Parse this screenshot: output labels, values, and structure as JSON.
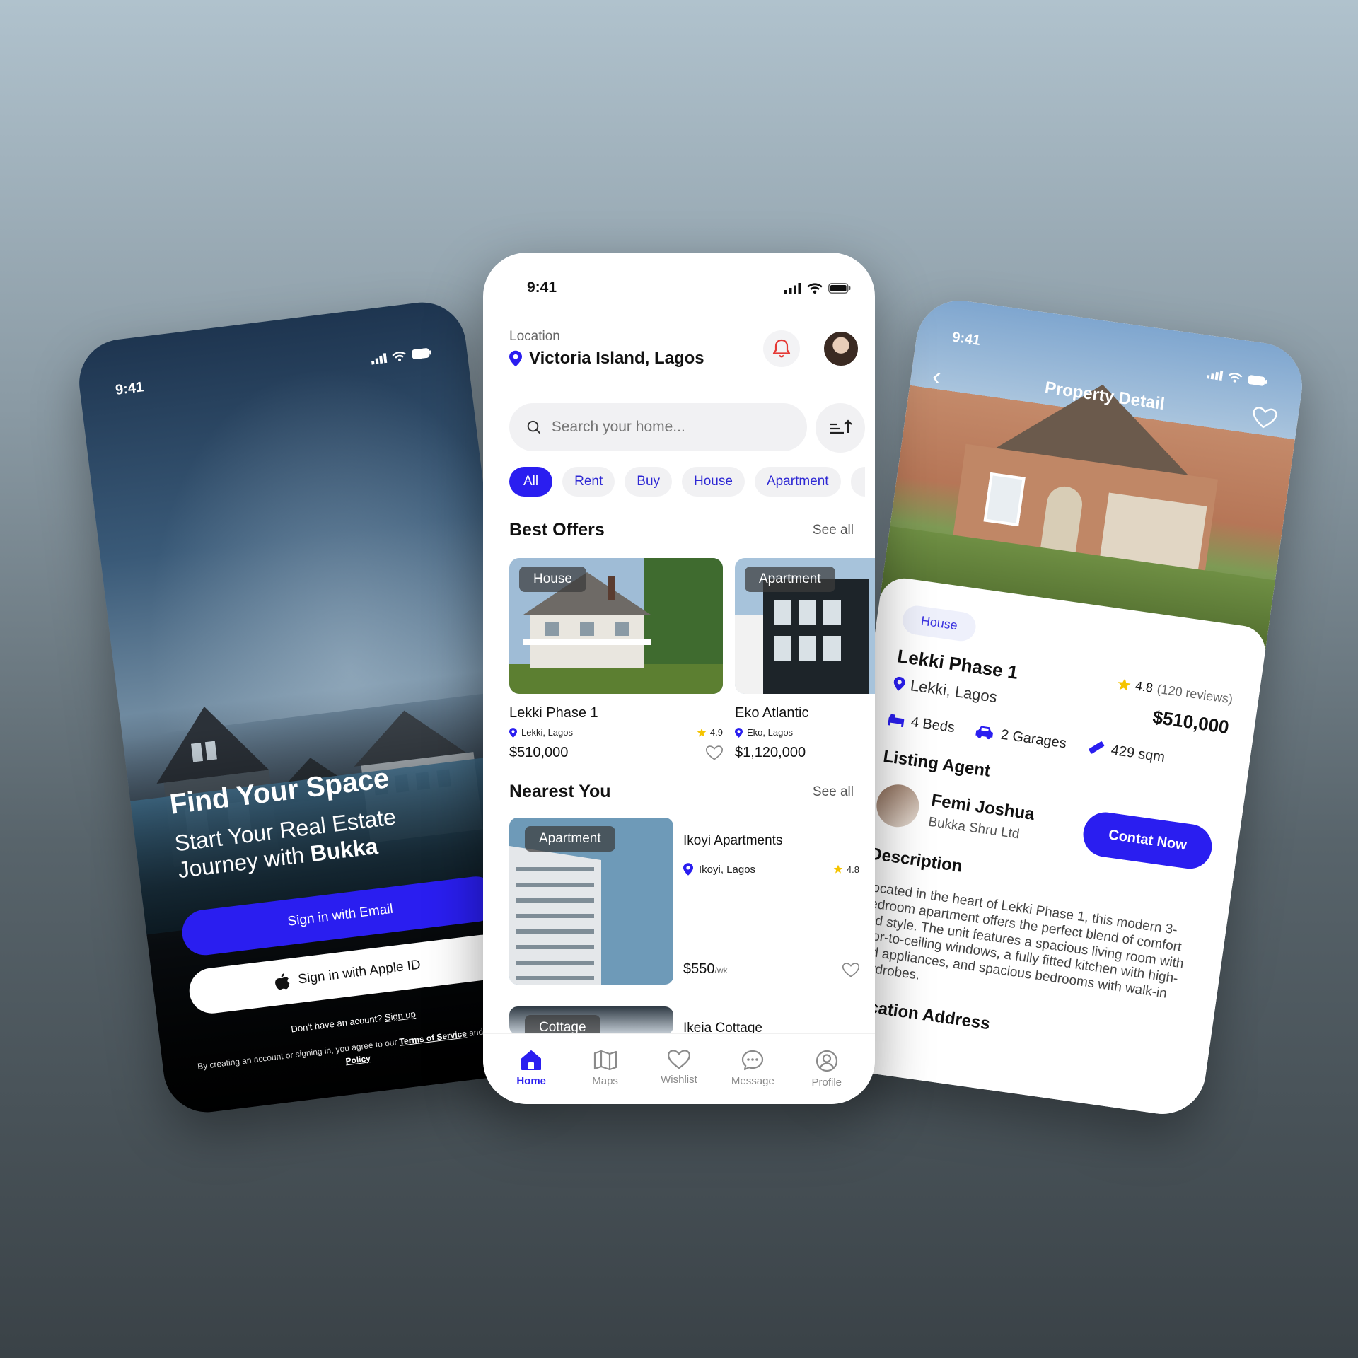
{
  "colors": {
    "accent": "#2a1ef0",
    "star": "#f5c400",
    "text": "#111111",
    "muted": "#666666"
  },
  "left_phone": {
    "time": "9:41",
    "headline": "Find Your Space",
    "subline_1": "Start Your Real Estate",
    "subline_2_prefix": "Journey with ",
    "brand": "Bukka",
    "email_button": "Sign in with Email",
    "apple_button": "Sign in with Apple ID",
    "signup_prompt": "Don't have an acount?",
    "signup_link": "Sign up",
    "terms_prefix": "By creating an account or signing in, you agree to our",
    "terms_link": "Terms of Service",
    "terms_and": "and",
    "privacy_link": "Privacy Policy"
  },
  "center_phone": {
    "time": "9:41",
    "location_label": "Location",
    "location_value": "Victoria Island, Lagos",
    "search_placeholder": "Search your home...",
    "filters": [
      "All",
      "Rent",
      "Buy",
      "House",
      "Apartment"
    ],
    "best_offers": {
      "title": "Best Offers",
      "see_all": "See all",
      "items": [
        {
          "tag": "House",
          "name": "Lekki Phase 1",
          "location": "Lekki, Lagos",
          "rating": "4.9",
          "price": "$510,000"
        },
        {
          "tag": "Apartment",
          "name": "Eko Atlantic",
          "location": "Eko, Lagos",
          "price": "$1,120,000"
        }
      ]
    },
    "nearest": {
      "title": "Nearest You",
      "see_all": "See all",
      "items": [
        {
          "tag": "Apartment",
          "name": "Ikoyi Apartments",
          "location": "Ikoyi, Lagos",
          "rating": "4.8",
          "price": "$550",
          "unit": "/wk"
        },
        {
          "tag": "Cottage",
          "name": "Ikeia Cottage"
        }
      ]
    },
    "tabs": [
      "Home",
      "Maps",
      "Wishlist",
      "Message",
      "Profile"
    ]
  },
  "right_phone": {
    "time": "9:41",
    "title": "Property Detail",
    "type": "House",
    "name": "Lekki Phase 1",
    "location": "Lekki, Lagos",
    "rating": "4.8",
    "reviews": "(120 reviews)",
    "price": "$510,000",
    "beds": "4 Beds",
    "garages": "2 Garages",
    "area": "429 sqm",
    "agent_section": "Listing Agent",
    "agent_name": "Femi Joshua",
    "agent_company": "Bukka Shru Ltd",
    "contact_button": "Contat Now",
    "description_section": "Description",
    "description": "Located in the heart of Lekki Phase 1, this modern 3-bedroom apartment offers the perfect blend of comfort and style. The unit features a spacious living room with floor-to-ceiling windows, a fully fitted kitchen with high-end appliances, and spacious bedrooms with walk-in wardrobes.",
    "address_section": "Location Address"
  }
}
